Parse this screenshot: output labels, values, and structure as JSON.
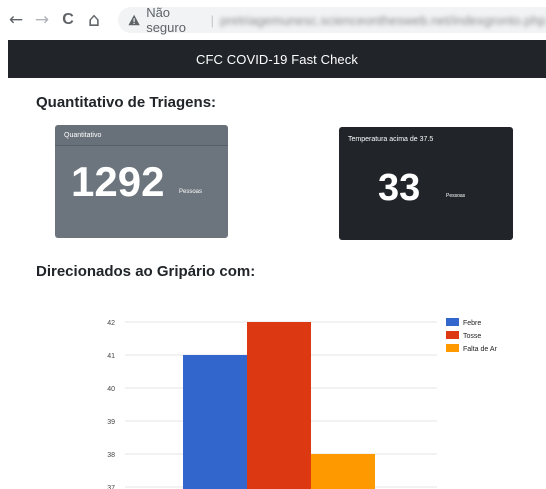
{
  "browser": {
    "back_icon": "←",
    "forward_icon": "→",
    "reload_icon": "C",
    "home_icon": "⌂",
    "security_label": "Não seguro",
    "url": "pretriagemunesc.scienceonthesweb.net/indexgronto.php"
  },
  "navbar": {
    "title": "CFC COVID-19 Fast Check"
  },
  "triagens": {
    "heading": "Quantitativo de Triagens:",
    "total": {
      "header": "Quantitativo",
      "value": "1292",
      "unit": "Pessoas"
    },
    "febre": {
      "header": "Temperatura acima de 37.5",
      "value": "33",
      "unit": "Pessoas"
    }
  },
  "gripario": {
    "heading": "Direcionados ao Gripário com:"
  },
  "colors": {
    "navbar": "#212529",
    "card_gray": "#6c757d",
    "card_dark": "#212529",
    "febre": "#3366cc",
    "tosse": "#dc3912",
    "falta_de_ar": "#ff9900"
  },
  "chart_data": {
    "type": "bar",
    "categories": [
      ""
    ],
    "series": [
      {
        "name": "Febre",
        "values": [
          41
        ],
        "color": "#3366cc"
      },
      {
        "name": "Tosse",
        "values": [
          42
        ],
        "color": "#dc3912"
      },
      {
        "name": "Falta de Ar",
        "values": [
          38
        ],
        "color": "#ff9900"
      }
    ],
    "yticks": [
      "42",
      "41",
      "40",
      "39",
      "38",
      "37"
    ],
    "ylim": [
      37,
      42
    ],
    "grid": true,
    "legend": "right"
  }
}
